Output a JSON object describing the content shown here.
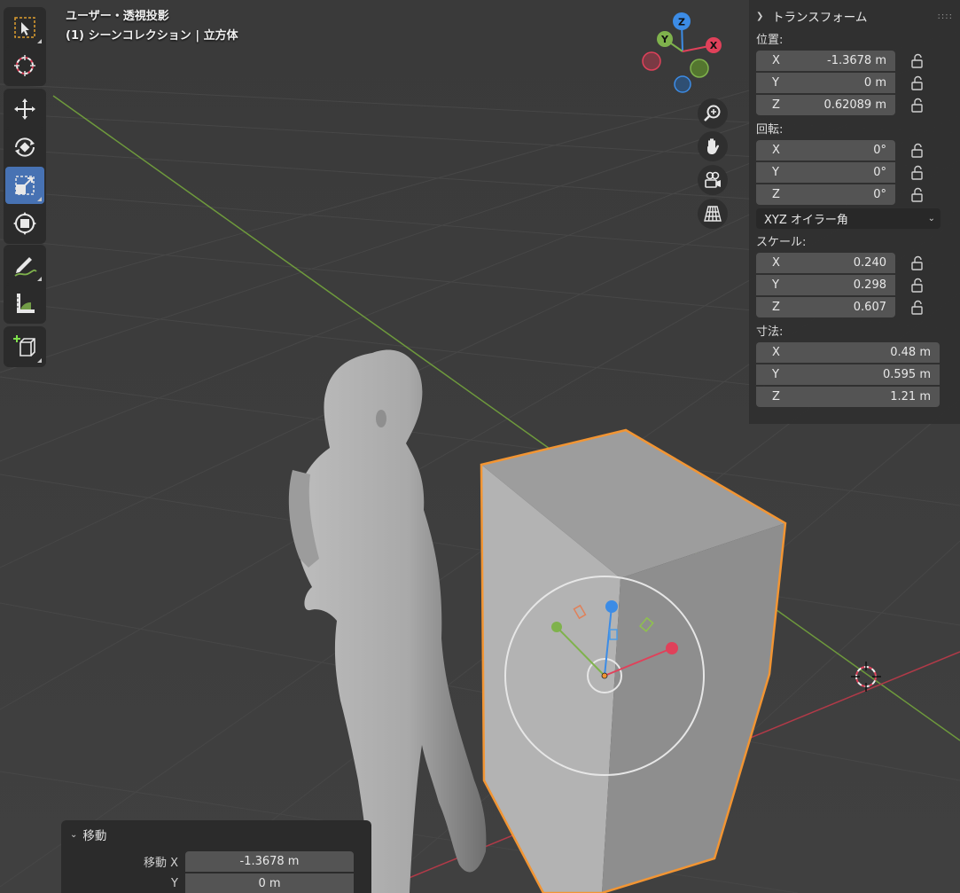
{
  "viewport": {
    "view_name": "ユーザー・透視投影",
    "collection_line": "(1) シーンコレクション | 立方体"
  },
  "gizmo": {
    "x_label": "X",
    "y_label": "Y",
    "z_label": "Z"
  },
  "toolbar": {
    "tools": [
      {
        "name": "select-box",
        "icon": "select-box-icon"
      },
      {
        "name": "cursor",
        "icon": "cursor-icon"
      },
      {
        "name": "move",
        "icon": "move-icon"
      },
      {
        "name": "rotate",
        "icon": "rotate-icon"
      },
      {
        "name": "scale",
        "icon": "scale-icon",
        "active": true
      },
      {
        "name": "transform",
        "icon": "transform-icon"
      },
      {
        "name": "annotate",
        "icon": "annotate-icon"
      },
      {
        "name": "measure",
        "icon": "measure-icon"
      },
      {
        "name": "add-cube",
        "icon": "add-cube-icon"
      }
    ]
  },
  "nav_buttons": [
    "zoom-icon",
    "pan-hand-icon",
    "camera-icon",
    "perspective-grid-icon"
  ],
  "npanel": {
    "title": "トランスフォーム",
    "location": {
      "label": "位置:",
      "x": {
        "axis": "X",
        "value": "-1.3678 m"
      },
      "y": {
        "axis": "Y",
        "value": "0 m"
      },
      "z": {
        "axis": "Z",
        "value": "0.62089 m"
      }
    },
    "rotation": {
      "label": "回転:",
      "x": {
        "axis": "X",
        "value": "0°"
      },
      "y": {
        "axis": "Y",
        "value": "0°"
      },
      "z": {
        "axis": "Z",
        "value": "0°"
      },
      "mode": "XYZ オイラー角"
    },
    "scale": {
      "label": "スケール:",
      "x": {
        "axis": "X",
        "value": "0.240"
      },
      "y": {
        "axis": "Y",
        "value": "0.298"
      },
      "z": {
        "axis": "Z",
        "value": "0.607"
      }
    },
    "dimensions": {
      "label": "寸法:",
      "x": {
        "axis": "X",
        "value": "0.48 m"
      },
      "y": {
        "axis": "Y",
        "value": "0.595 m"
      },
      "z": {
        "axis": "Z",
        "value": "1.21 m"
      }
    }
  },
  "operator": {
    "title": "移動",
    "rows": [
      {
        "label": "移動 X",
        "value": "-1.3678 m"
      },
      {
        "label": "Y",
        "value": "0 m"
      }
    ]
  },
  "colors": {
    "background": "#3d3d3d",
    "grid": "#4a4a4a",
    "x_axis": "#e0415a",
    "y_axis": "#7fb24c",
    "z_axis": "#3c8ce6",
    "selection": "#f29533",
    "active_tool": "#4772b3"
  }
}
